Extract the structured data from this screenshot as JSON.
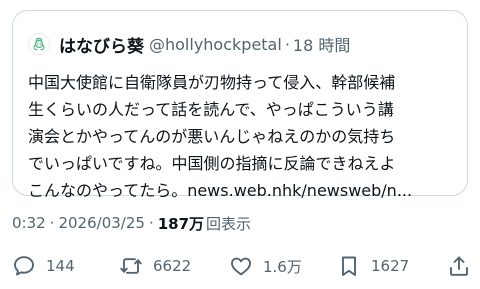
{
  "quote": {
    "display_name": "はなびら葵",
    "handle": "@hollyhockpetal",
    "separator": "·",
    "time_ago": "18 時間",
    "lines": [
      "中国大使館に自衛隊員が刃物持って侵入、幹部候補",
      "生くらいの人だって話を読んで、やっぱこういう講",
      "演会とかやってんのが悪いんじゃねえのかの気持ち",
      "でいっぱいですね。中国側の指摘に反論できねえよ",
      "こんなのやってたら。news.web.nhk/newsweb/n..."
    ]
  },
  "meta": {
    "time": "0:32",
    "separator": "·",
    "date": "2026/03/25",
    "separator2": "·",
    "views_count": "187万",
    "views_label": "回表示"
  },
  "actions": {
    "replies": "144",
    "reposts": "6622",
    "likes": "1.6万",
    "bookmarks": "1627"
  },
  "icons": {
    "avatar": "hollyhock-avatar-icon",
    "reply": "reply-icon",
    "repost": "repost-icon",
    "like": "heart-icon",
    "bookmark": "bookmark-icon",
    "share": "share-icon"
  },
  "colors": {
    "text": "#0f1419",
    "secondary": "#536471",
    "border": "#cfd9de"
  }
}
